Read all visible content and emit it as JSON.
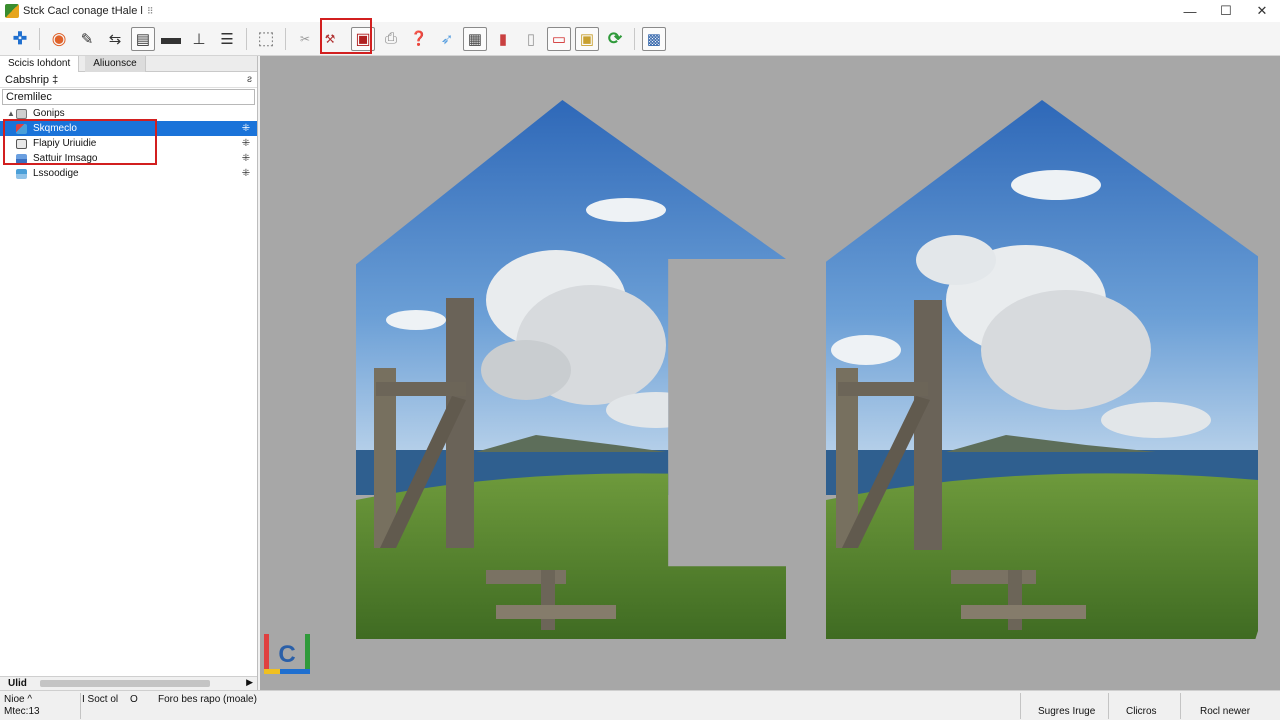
{
  "window": {
    "title": "Stck Cacl conage tHale l",
    "title_glyph": "⠿",
    "controls": {
      "minimize": "—",
      "maximize": "☐",
      "close": "✕"
    }
  },
  "toolbar": {
    "buttons": [
      {
        "name": "connect-icon",
        "glyph": "✜",
        "color": "#1f6fcf"
      },
      {
        "name": "browser-icon",
        "glyph": "◉",
        "color": "#e0622a"
      },
      {
        "name": "pen-icon",
        "glyph": "✎",
        "color": "#333333"
      },
      {
        "name": "arrows-icon",
        "glyph": "⇆",
        "color": "#333333"
      },
      {
        "name": "document-icon",
        "glyph": "▤",
        "color": "#333333"
      },
      {
        "name": "layer-icon",
        "glyph": "▬",
        "color": "#333333"
      },
      {
        "name": "split-icon",
        "glyph": "⊥",
        "color": "#333333"
      },
      {
        "name": "align-icon",
        "glyph": "☰",
        "color": "#333333"
      },
      {
        "name": "frame-icon",
        "glyph": "⬚",
        "color": "#777777"
      },
      {
        "name": "cut-icon",
        "glyph": "✂",
        "color": "#888888"
      },
      {
        "name": "hammer-icon",
        "glyph": "⚒",
        "color": "#b03030"
      },
      {
        "name": "image-stamp-icon",
        "glyph": "▣",
        "color": "#b02020"
      },
      {
        "name": "print-icon",
        "glyph": "⎙",
        "color": "#888888"
      },
      {
        "name": "help-icon",
        "glyph": "❓",
        "color": "#1f6fcf"
      },
      {
        "name": "wing-icon",
        "glyph": "➶",
        "color": "#5aa0e0"
      },
      {
        "name": "page-icon",
        "glyph": "▦",
        "color": "#444444"
      },
      {
        "name": "palette-icon",
        "glyph": "▮",
        "color": "#c94040"
      },
      {
        "name": "bookmark-icon",
        "glyph": "▯",
        "color": "#999999"
      },
      {
        "name": "slides-icon",
        "glyph": "▭",
        "color": "#d23030"
      },
      {
        "name": "folder-icon",
        "glyph": "▣",
        "color": "#c8a030"
      },
      {
        "name": "refresh-icon",
        "glyph": "⟳",
        "color": "#2f9a3a"
      },
      {
        "name": "gallery-icon",
        "glyph": "▩",
        "color": "#2a5fa8"
      }
    ]
  },
  "left_panel": {
    "tabs": {
      "first": "Scicis Iohdont",
      "second": "Aliuonsce"
    },
    "header_row": "Cabshrip ‡",
    "header_glyph": "ƨ",
    "search_value": "Cremlilec",
    "items": [
      {
        "label": "Gonips",
        "pin": "",
        "selected": false,
        "icon_color": "#777777"
      },
      {
        "label": "Skqmeclo",
        "pin": "⁜",
        "selected": true,
        "icon_color": "#e04040"
      },
      {
        "label": "Flapiy Uriuidie",
        "pin": "⁜",
        "selected": false,
        "icon_color": "#555555"
      },
      {
        "label": "Sattuir Imsago",
        "pin": "⁜",
        "selected": false,
        "icon_color": "#3a6fc0"
      },
      {
        "label": "Lssoodige",
        "pin": "⁜",
        "selected": false,
        "icon_color": "#4a9fd8"
      }
    ],
    "bottom_label": "Ulid"
  },
  "status_bar": {
    "line1": "Nioe ^",
    "line2": "Mtec:13",
    "pages": "I  Soct ol",
    "dot": "O",
    "field": "Foro bes rapo (moale)",
    "right1": "Sugres Iruge",
    "right2": "Clicros",
    "right3": "Rocl newer"
  },
  "colors": {
    "accent": "#1a73d9",
    "highlight_box": "#d21f1f",
    "canvas_bg": "#a7a7a7"
  }
}
